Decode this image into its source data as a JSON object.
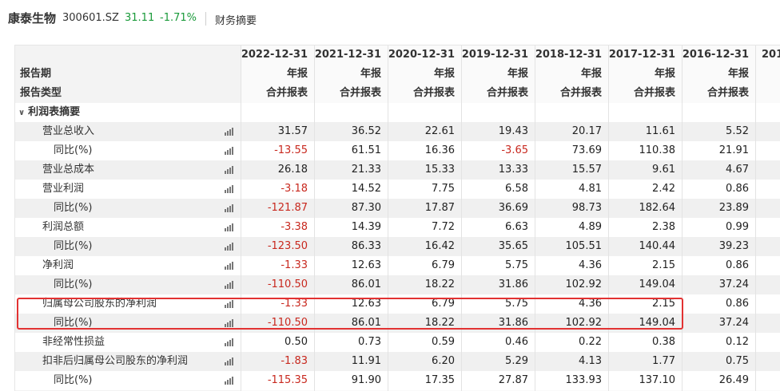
{
  "header": {
    "company": "康泰生物",
    "code": "300601.SZ",
    "price": "31.11",
    "change": "-1.71%",
    "tab": "财务摘要"
  },
  "table": {
    "report_period_label": "报告期",
    "report_type_label": "报告类型",
    "columns": [
      {
        "date": "2022-12-31",
        "period": "年报",
        "type": "合并报表"
      },
      {
        "date": "2021-12-31",
        "period": "年报",
        "type": "合并报表"
      },
      {
        "date": "2020-12-31",
        "period": "年报",
        "type": "合并报表"
      },
      {
        "date": "2019-12-31",
        "period": "年报",
        "type": "合并报表"
      },
      {
        "date": "2018-12-31",
        "period": "年报",
        "type": "合并报表"
      },
      {
        "date": "2017-12-31",
        "period": "年报",
        "type": "合并报表"
      },
      {
        "date": "2016-12-31",
        "period": "年报",
        "type": "合并报表"
      },
      {
        "date": "201",
        "period": "",
        "type": ""
      }
    ],
    "section_label": "利润表摘要",
    "rows": [
      {
        "label": "营业总收入",
        "indent": 1,
        "values": [
          "31.57",
          "36.52",
          "22.61",
          "19.43",
          "20.17",
          "11.61",
          "5.52"
        ]
      },
      {
        "label": "同比(%)",
        "indent": 2,
        "values": [
          "-13.55",
          "61.51",
          "16.36",
          "-3.65",
          "73.69",
          "110.38",
          "21.91"
        ]
      },
      {
        "label": "营业总成本",
        "indent": 1,
        "values": [
          "26.18",
          "21.33",
          "15.33",
          "13.33",
          "15.57",
          "9.61",
          "4.67"
        ]
      },
      {
        "label": "营业利润",
        "indent": 1,
        "values": [
          "-3.18",
          "14.52",
          "7.75",
          "6.58",
          "4.81",
          "2.42",
          "0.86"
        ]
      },
      {
        "label": "同比(%)",
        "indent": 2,
        "values": [
          "-121.87",
          "87.30",
          "17.87",
          "36.69",
          "98.73",
          "182.64",
          "23.89"
        ]
      },
      {
        "label": "利润总额",
        "indent": 1,
        "values": [
          "-3.38",
          "14.39",
          "7.72",
          "6.63",
          "4.89",
          "2.38",
          "0.99"
        ]
      },
      {
        "label": "同比(%)",
        "indent": 2,
        "values": [
          "-123.50",
          "86.33",
          "16.42",
          "35.65",
          "105.51",
          "140.44",
          "39.23"
        ]
      },
      {
        "label": "净利润",
        "indent": 1,
        "values": [
          "-1.33",
          "12.63",
          "6.79",
          "5.75",
          "4.36",
          "2.15",
          "0.86"
        ]
      },
      {
        "label": "同比(%)",
        "indent": 2,
        "values": [
          "-110.50",
          "86.01",
          "18.22",
          "31.86",
          "102.92",
          "149.04",
          "37.24"
        ]
      },
      {
        "label": "归属母公司股东的净利润",
        "indent": 1,
        "values": [
          "-1.33",
          "12.63",
          "6.79",
          "5.75",
          "4.36",
          "2.15",
          "0.86"
        ]
      },
      {
        "label": "同比(%)",
        "indent": 2,
        "values": [
          "-110.50",
          "86.01",
          "18.22",
          "31.86",
          "102.92",
          "149.04",
          "37.24"
        ]
      },
      {
        "label": "非经常性损益",
        "indent": 1,
        "values": [
          "0.50",
          "0.73",
          "0.59",
          "0.46",
          "0.22",
          "0.38",
          "0.12"
        ]
      },
      {
        "label": "扣非后归属母公司股东的净利润",
        "indent": 1,
        "values": [
          "-1.83",
          "11.91",
          "6.20",
          "5.29",
          "4.13",
          "1.77",
          "0.75"
        ]
      },
      {
        "label": "同比(%)",
        "indent": 2,
        "values": [
          "-115.35",
          "91.90",
          "17.35",
          "27.87",
          "133.93",
          "137.10",
          "26.49"
        ]
      }
    ]
  },
  "colors": {
    "negative": "#c8281e",
    "price_change": "#1a9a3a",
    "highlight_box": "#e23232"
  }
}
